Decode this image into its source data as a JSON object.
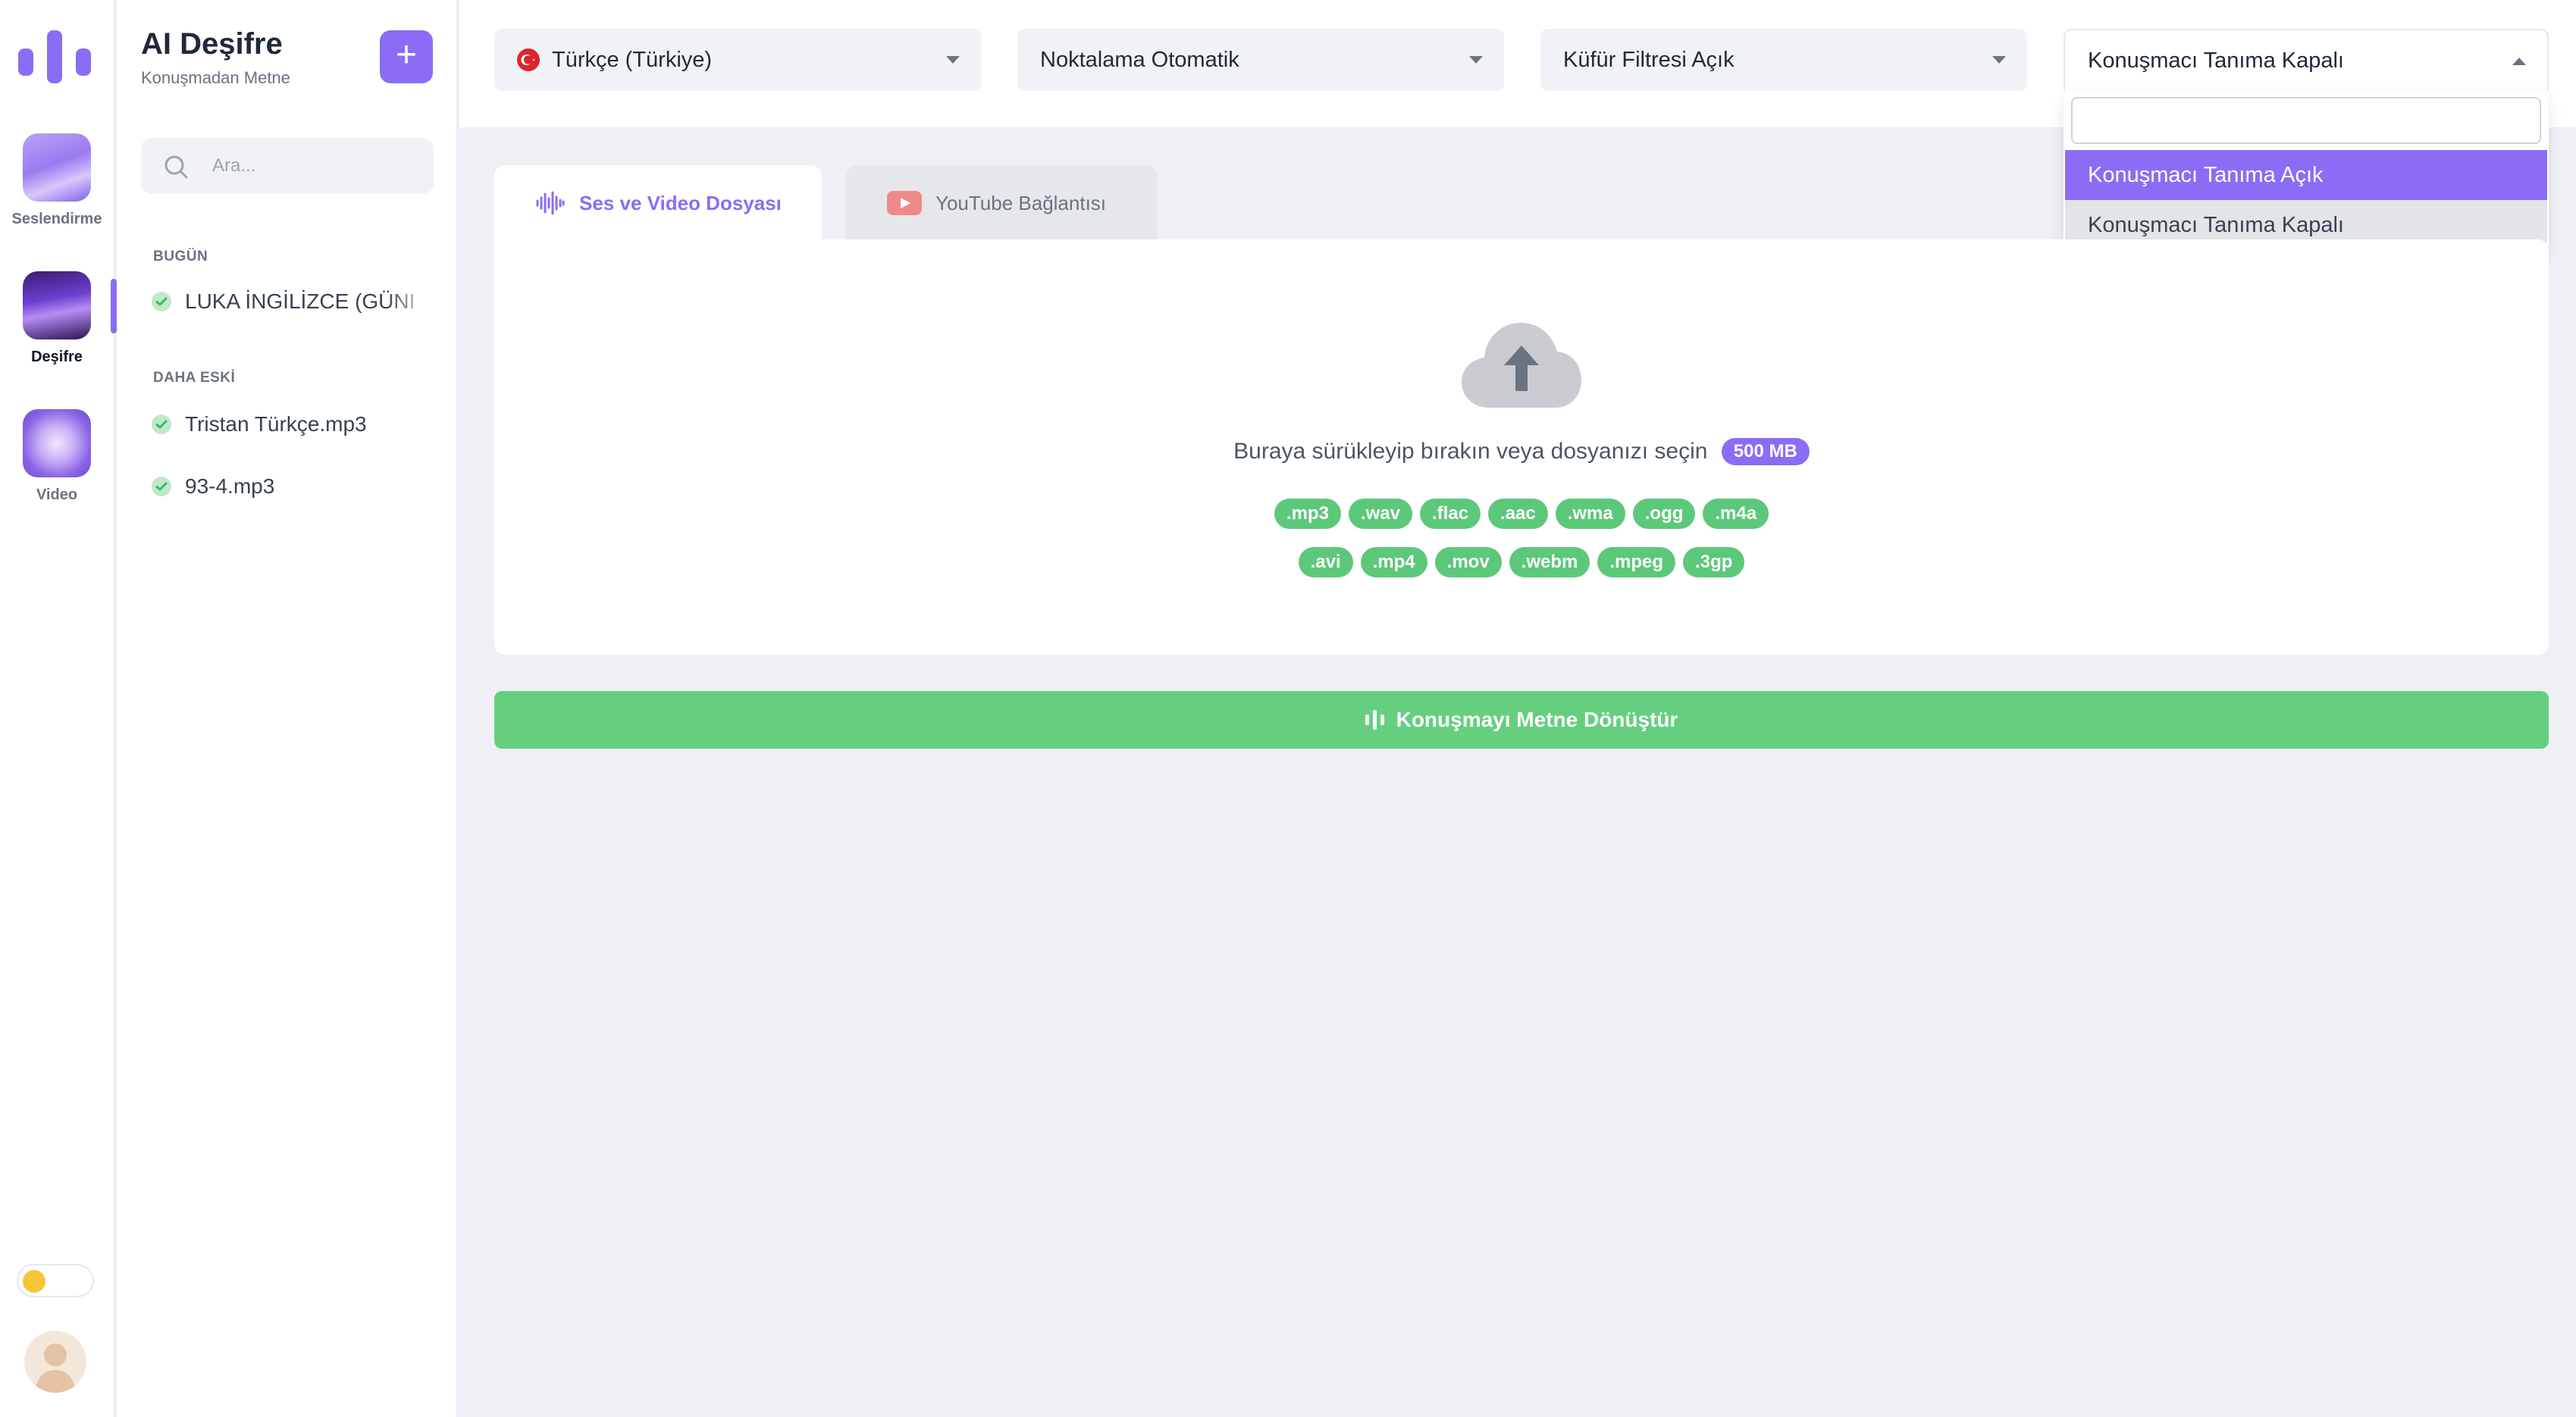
{
  "rail": {
    "apps": [
      {
        "label": "Seslendirme"
      },
      {
        "label": "Deşifre"
      },
      {
        "label": "Video"
      }
    ]
  },
  "sidebar": {
    "title": "AI Deşifre",
    "subtitle": "Konuşmadan Metne",
    "add_symbol": "+",
    "search_placeholder": "Ara...",
    "groups": [
      {
        "label": "BUGÜN",
        "items": [
          {
            "name": "LUKA İNGİLİZCE (GÜNI"
          }
        ]
      },
      {
        "label": "DAHA ESKİ",
        "items": [
          {
            "name": "Tristan Türkçe.mp3"
          },
          {
            "name": "93-4.mp3"
          }
        ]
      }
    ]
  },
  "toolbar": {
    "language": "Türkçe (Türkiye)",
    "punctuation": "Noktalama Otomatik",
    "profanity": "Küfür Filtresi Açık",
    "diarization": "Konuşmacı Tanıma Kapalı"
  },
  "dropdown": {
    "search_value": "",
    "options": [
      {
        "label": "Konuşmacı Tanıma Açık",
        "state": "highlighted"
      },
      {
        "label": "Konuşmacı Tanıma Kapalı",
        "state": "selected"
      }
    ]
  },
  "tabs": [
    {
      "label": "Ses ve Video Dosyası",
      "active": true
    },
    {
      "label": "YouTube Bağlantısı",
      "active": false
    }
  ],
  "upload": {
    "prompt": "Buraya sürükleyip bırakın veya dosyanızı seçin",
    "max_size": "500 MB",
    "extensions_row1": [
      ".mp3",
      ".wav",
      ".flac",
      ".aac",
      ".wma",
      ".ogg",
      ".m4a"
    ],
    "extensions_row2": [
      ".avi",
      ".mp4",
      ".mov",
      ".webm",
      ".mpeg",
      ".3gp"
    ]
  },
  "convert_button": "Konuşmayı Metne Dönüştür",
  "colors": {
    "accent": "#8b6cf5",
    "success": "#65cf7f",
    "chip": "#5cc87a",
    "background": "#eef0f5"
  }
}
